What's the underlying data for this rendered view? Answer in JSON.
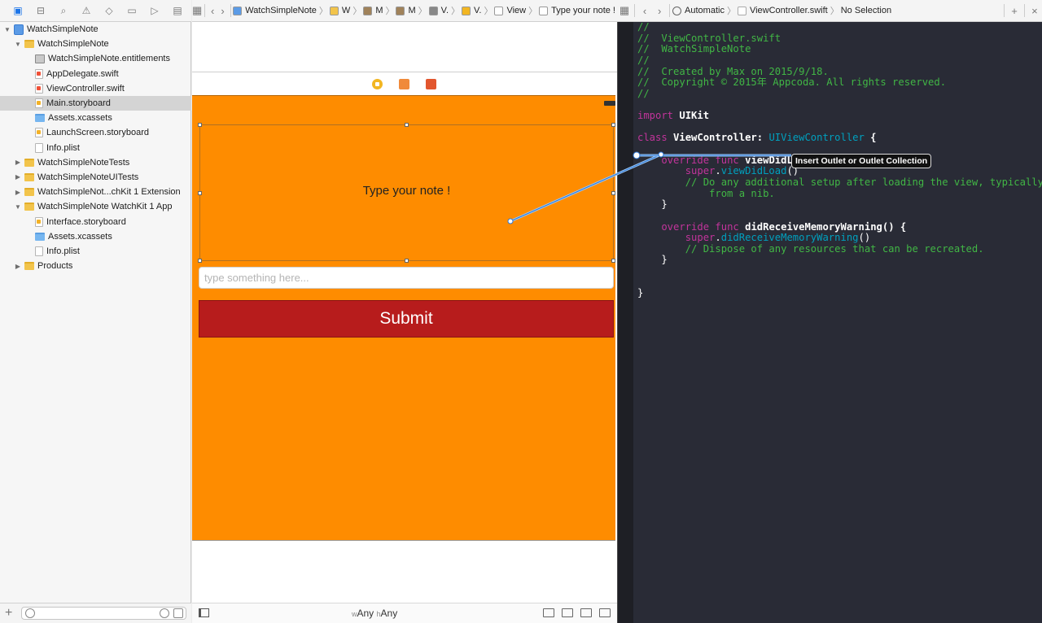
{
  "navigator": {
    "toolbar_icons": [
      "folder-icon",
      "warning-hierarchy-icon",
      "search-icon",
      "issue-icon",
      "test-icon",
      "debug-icon",
      "breakpoint-icon",
      "report-icon"
    ],
    "tree": [
      {
        "label": "WatchSimpleNote",
        "icon": "project",
        "indent": 0,
        "expanded": true
      },
      {
        "label": "WatchSimpleNote",
        "icon": "folder",
        "indent": 1,
        "expanded": true
      },
      {
        "label": "WatchSimpleNote.entitlements",
        "icon": "entitlements",
        "indent": 2
      },
      {
        "label": "AppDelegate.swift",
        "icon": "swift",
        "indent": 2
      },
      {
        "label": "ViewController.swift",
        "icon": "swift",
        "indent": 2
      },
      {
        "label": "Main.storyboard",
        "icon": "storyboard",
        "indent": 2,
        "selected": true
      },
      {
        "label": "Assets.xcassets",
        "icon": "bluefolder",
        "indent": 2
      },
      {
        "label": "LaunchScreen.storyboard",
        "icon": "storyboard",
        "indent": 2
      },
      {
        "label": "Info.plist",
        "icon": "file",
        "indent": 2
      },
      {
        "label": "WatchSimpleNoteTests",
        "icon": "folder",
        "indent": 1,
        "expanded": false
      },
      {
        "label": "WatchSimpleNoteUITests",
        "icon": "folder",
        "indent": 1,
        "expanded": false
      },
      {
        "label": "WatchSimpleNot...chKit 1 Extension",
        "icon": "folder",
        "indent": 1,
        "expanded": false
      },
      {
        "label": "WatchSimpleNote WatchKit 1 App",
        "icon": "folder",
        "indent": 1,
        "expanded": true
      },
      {
        "label": "Interface.storyboard",
        "icon": "storyboard",
        "indent": 2
      },
      {
        "label": "Assets.xcassets",
        "icon": "bluefolder",
        "indent": 2
      },
      {
        "label": "Info.plist",
        "icon": "file",
        "indent": 2
      },
      {
        "label": "Products",
        "icon": "folder",
        "indent": 1,
        "expanded": false
      }
    ]
  },
  "canvas": {
    "breadcrumbs": [
      "WatchSimpleNote",
      "W",
      "M",
      "M",
      "V.",
      "V.",
      "View",
      "Type your note !"
    ],
    "note_label": "Type your note !",
    "input_placeholder": "type something here...",
    "submit_label": "Submit",
    "size_class": {
      "w_prefix": "w",
      "w_value": "Any",
      "h_prefix": "h",
      "h_value": "Any"
    },
    "colors": {
      "scene_background": "#fe8c00",
      "submit_background": "#b71c1c"
    }
  },
  "editor": {
    "mode": "Automatic",
    "file": "ViewController.swift",
    "selection": "No Selection",
    "tooltip": "Insert Outlet or Outlet Collection",
    "code_lines": [
      [
        {
          "t": "//",
          "c": "com"
        }
      ],
      [
        {
          "t": "//  ViewController.swift",
          "c": "com"
        }
      ],
      [
        {
          "t": "//  WatchSimpleNote",
          "c": "com"
        }
      ],
      [
        {
          "t": "//",
          "c": "com"
        }
      ],
      [
        {
          "t": "//  Created by Max on 2015/9/18.",
          "c": "com"
        }
      ],
      [
        {
          "t": "//  Copyright © 2015年 Appcoda. All rights reserved.",
          "c": "com"
        }
      ],
      [
        {
          "t": "//",
          "c": "com"
        }
      ],
      [
        {
          "t": "",
          "c": ""
        }
      ],
      [
        {
          "t": "import",
          "c": "kw"
        },
        {
          "t": " UIKit",
          "c": "bold"
        }
      ],
      [
        {
          "t": "",
          "c": ""
        }
      ],
      [
        {
          "t": "class",
          "c": "kw"
        },
        {
          "t": " ViewController: ",
          "c": "bold"
        },
        {
          "t": "UIViewController",
          "c": "type"
        },
        {
          "t": " {",
          "c": "bold"
        }
      ],
      [
        {
          "t": "",
          "c": ""
        }
      ],
      [
        {
          "t": "    override",
          "c": "kw"
        },
        {
          "t": " ",
          "c": ""
        },
        {
          "t": "func",
          "c": "kw"
        },
        {
          "t": " viewDidLo",
          "c": "bold"
        }
      ],
      [
        {
          "t": "        super",
          "c": "kw"
        },
        {
          "t": ".",
          "c": ""
        },
        {
          "t": "viewDidLoad",
          "c": "type"
        },
        {
          "t": "()",
          "c": ""
        }
      ],
      [
        {
          "t": "        // Do any additional setup after loading the view, typically",
          "c": "com"
        }
      ],
      [
        {
          "t": "            from a nib.",
          "c": "com"
        }
      ],
      [
        {
          "t": "    }",
          "c": ""
        }
      ],
      [
        {
          "t": "",
          "c": ""
        }
      ],
      [
        {
          "t": "    override",
          "c": "kw"
        },
        {
          "t": " ",
          "c": ""
        },
        {
          "t": "func",
          "c": "kw"
        },
        {
          "t": " didReceiveMemoryWarning() {",
          "c": "bold"
        }
      ],
      [
        {
          "t": "        super",
          "c": "kw"
        },
        {
          "t": ".",
          "c": ""
        },
        {
          "t": "didReceiveMemoryWarning",
          "c": "type"
        },
        {
          "t": "()",
          "c": ""
        }
      ],
      [
        {
          "t": "        // Dispose of any resources that can be recreated.",
          "c": "com"
        }
      ],
      [
        {
          "t": "    }",
          "c": ""
        }
      ],
      [
        {
          "t": "",
          "c": ""
        }
      ],
      [
        {
          "t": "",
          "c": ""
        }
      ],
      [
        {
          "t": "}",
          "c": ""
        }
      ]
    ]
  }
}
